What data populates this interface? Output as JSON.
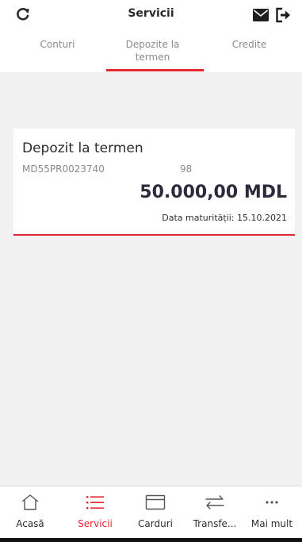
{
  "header": {
    "title": "Servicii",
    "icons": [
      "refresh-icon",
      "mail-icon",
      "logout-icon"
    ]
  },
  "tabs": [
    {
      "label": "Conturi",
      "active": false
    },
    {
      "label": "Depozite la\ntermen",
      "active": true
    },
    {
      "label": "Credite",
      "active": false
    }
  ],
  "deposit": {
    "title": "Depozit la termen",
    "account": "MD55PR0023740",
    "account_suffix": "98",
    "amount": "50.000,00 MDL",
    "maturity": "Data maturității: 15.10.2021"
  },
  "bottom_nav": [
    {
      "label": "Acasă",
      "icon": "home-icon",
      "active": false
    },
    {
      "label": "Servicii",
      "icon": "list-icon",
      "active": true
    },
    {
      "label": "Carduri",
      "icon": "card-icon",
      "active": false
    },
    {
      "label": "Transfe...",
      "icon": "transfer-icon",
      "active": false
    },
    {
      "label": "Mai mult",
      "icon": "more-icon",
      "active": false
    }
  ],
  "colors": {
    "accent": "#e3262f",
    "background": "#f1f1f1",
    "text": "#2d2d2d",
    "muted": "#8a8a8a"
  }
}
